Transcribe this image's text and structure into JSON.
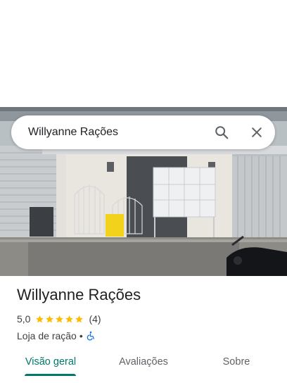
{
  "search": {
    "query": "Willyanne Rações"
  },
  "place": {
    "name": "Willyanne Rações",
    "rating_value": "5,0",
    "rating_stars": 5,
    "review_count": "(4)",
    "category": "Loja de ração",
    "separator": "•"
  },
  "tabs": [
    {
      "label": "Visão geral",
      "active": true
    },
    {
      "label": "Avaliações",
      "active": false
    },
    {
      "label": "Sobre",
      "active": false
    }
  ],
  "colors": {
    "accent": "#00796b",
    "star": "#fbbc04",
    "accessibility": "#1a73e8"
  },
  "icons": {
    "search": "search-icon",
    "close": "close-icon",
    "accessibility": "wheelchair-icon"
  }
}
